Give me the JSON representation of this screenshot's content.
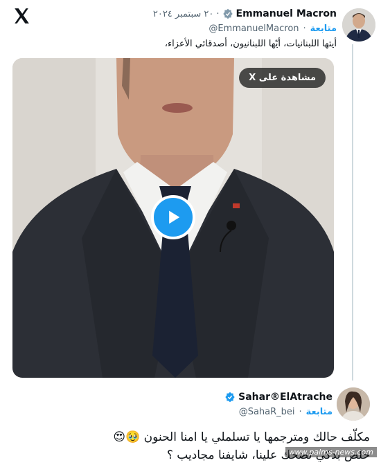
{
  "app": {
    "logo": "x-logo-icon"
  },
  "tweet1": {
    "name": "Emmanuel Macron",
    "date": "٢٠ سبتمبر ٢٠٢٤",
    "handle": "@EmmanuelMacron",
    "follow_label": "متابعة",
    "text": "أيتها اللبنانيات، أيّها اللبنانيون، أصدقائي الأعزاء،",
    "video": {
      "watch_label": "مشاهدة على X",
      "play_icon": "play-icon"
    }
  },
  "tweet2": {
    "name": "Sahar®ElAtrache",
    "handle": "@SahaR_bei",
    "follow_label": "متابعة",
    "text_line1": "مكلّف حالك ومترجمها يا تسلملي يا امنا الحنون 🥹😍",
    "text_line2": "خلص بدكي تضحك علينا، شايفنا مجاديب ؟"
  },
  "watermark": "www.palms-news.com",
  "colors": {
    "accent": "#1d9bf0",
    "secondary_text": "#536471"
  }
}
